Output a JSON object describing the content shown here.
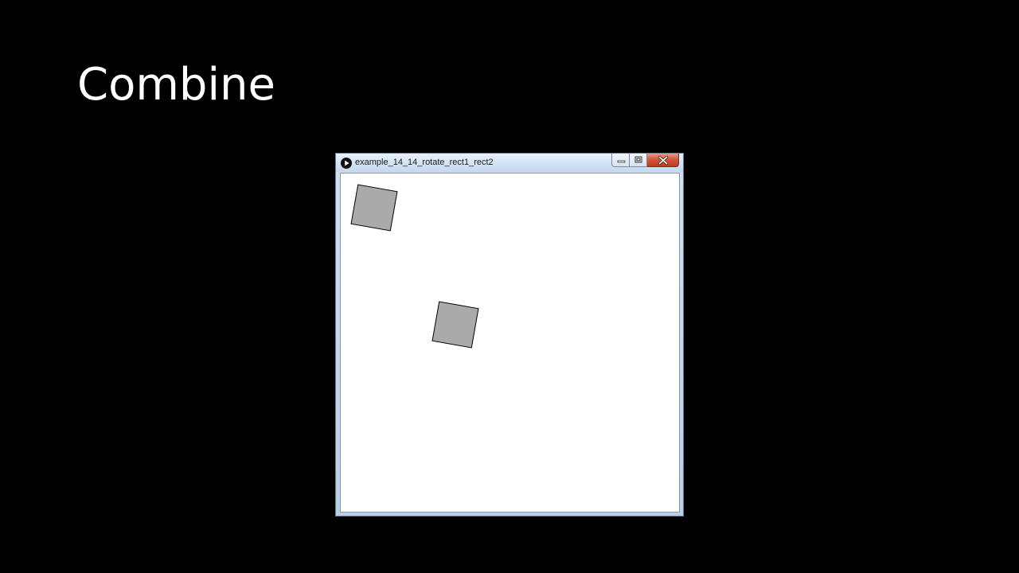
{
  "slide": {
    "title": "Combine",
    "background": "#000000",
    "title_color": "#ffffff"
  },
  "window": {
    "title": "example_14_14_rotate_rect1_rect2",
    "app_icon": "play-icon",
    "caption_buttons": [
      "minimize-icon",
      "maximize-icon",
      "close-icon"
    ],
    "close_button_color": "#c8462f"
  },
  "canvas": {
    "background": "#ffffff",
    "shapes": [
      {
        "type": "rect",
        "fill": "#aaaaaa",
        "stroke": "#000000"
      },
      {
        "type": "rect",
        "fill": "#aaaaaa",
        "stroke": "#000000"
      }
    ]
  }
}
